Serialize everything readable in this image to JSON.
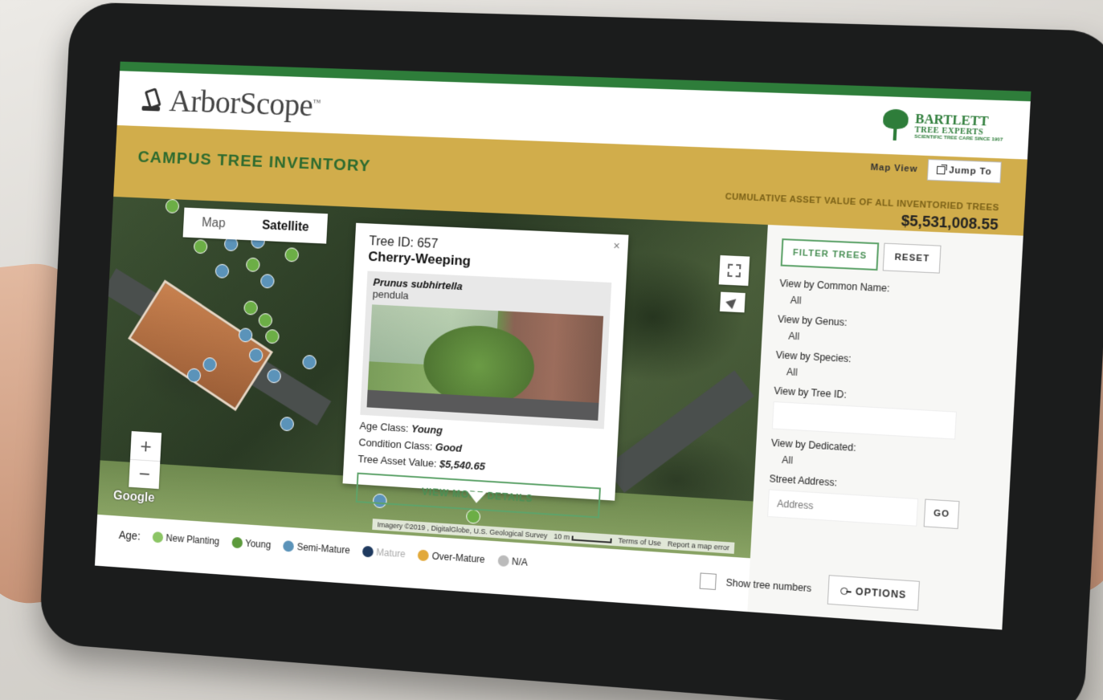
{
  "header": {
    "app_name": "ArborScope",
    "trademark": "™",
    "partner": {
      "name": "BARTLETT",
      "sub": "TREE EXPERTS",
      "tagline": "SCIENTIFIC TREE CARE SINCE 1907"
    }
  },
  "band": {
    "title": "CAMPUS TREE INVENTORY",
    "map_view_label": "Map View",
    "jump_to_label": "Jump To",
    "asset_caption": "CUMULATIVE ASSET VALUE OF ALL INVENTORIED TREES",
    "asset_value": "$5,531,008.55"
  },
  "map": {
    "type_tabs": [
      {
        "label": "Map",
        "active": false
      },
      {
        "label": "Satellite",
        "active": true
      }
    ],
    "zoom_in": "+",
    "zoom_out": "−",
    "google": "Google",
    "attribution": "Imagery ©2019 , DigitalGlobe, U.S. Geological Survey",
    "scale": "10 m",
    "terms": "Terms of Use",
    "report": "Report a map error"
  },
  "popup": {
    "close": "×",
    "tree_id": "Tree ID: 657",
    "common_name": "Cherry-Weeping",
    "scientific_name": "Prunus subhirtella",
    "variety": "pendula",
    "age_label": "Age Class: ",
    "age_value": "Young",
    "condition_label": "Condition Class: ",
    "condition_value": "Good",
    "asset_label": "Tree Asset Value: ",
    "asset_value": "$5,540.65",
    "more_button": "VIEW MORE DETAILS"
  },
  "legend": {
    "title": "Age:",
    "items": [
      {
        "label": "New Planting",
        "color": "#8cc565"
      },
      {
        "label": "Young",
        "color": "#5c9a3c"
      },
      {
        "label": "Semi-Mature",
        "color": "#5b93b9"
      },
      {
        "label": "Mature",
        "color": "#1f3a5f"
      },
      {
        "label": "Over-Mature",
        "color": "#e2a93a"
      },
      {
        "label": "N/A",
        "color": "#bbbbbb"
      }
    ]
  },
  "sidebar": {
    "filter_button": "FILTER TREES",
    "reset_button": "RESET",
    "common_name_label": "View by Common Name:",
    "common_name_value": "All",
    "genus_label": "View by Genus:",
    "genus_value": "All",
    "species_label": "View by Species:",
    "species_value": "All",
    "tree_id_label": "View by Tree ID:",
    "dedicated_label": "View by Dedicated:",
    "dedicated_value": "All",
    "street_label": "Street Address:",
    "address_placeholder": "Address",
    "go_button": "GO",
    "show_numbers_label": "Show tree numbers",
    "options_button": "OPTIONS"
  },
  "colors": {
    "brand_green": "#2e7d3a",
    "band_gold": "#d1ad4b",
    "accent_green": "#5ea36a",
    "semi_mature_dot": "#5b93b9",
    "young_dot": "#6cae46"
  }
}
